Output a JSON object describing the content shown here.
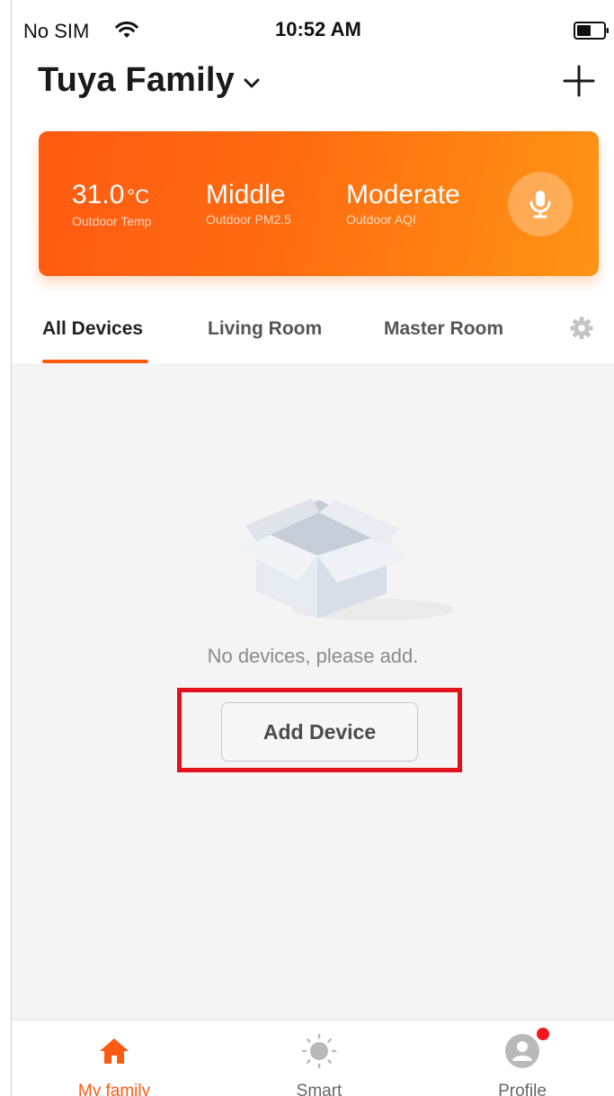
{
  "status_bar": {
    "carrier": "No SIM",
    "time": "10:52 AM"
  },
  "header": {
    "title": "Tuya Family"
  },
  "weather": {
    "temperature": {
      "value": "31.0",
      "unit": "°C",
      "label": "Outdoor Temp"
    },
    "pm25": {
      "value": "Middle",
      "label": "Outdoor PM2.5"
    },
    "aqi": {
      "value": "Moderate",
      "label": "Outdoor AQI"
    }
  },
  "tabs": [
    {
      "label": "All Devices",
      "active": true
    },
    {
      "label": "Living Room",
      "active": false
    },
    {
      "label": "Master Room",
      "active": false
    }
  ],
  "empty_state": {
    "message": "No devices, please add.",
    "button_label": "Add Device"
  },
  "bottom_nav": [
    {
      "label": "My family",
      "icon": "home-icon",
      "active": true
    },
    {
      "label": "Smart",
      "icon": "sun-icon",
      "active": false
    },
    {
      "label": "Profile",
      "icon": "profile-icon",
      "active": false,
      "badge": true
    }
  ],
  "colors": {
    "accent": "#ff5a12",
    "card_gradient_end": "#ff9416",
    "highlight": "#e0111b",
    "background": "#f4f4f4"
  }
}
